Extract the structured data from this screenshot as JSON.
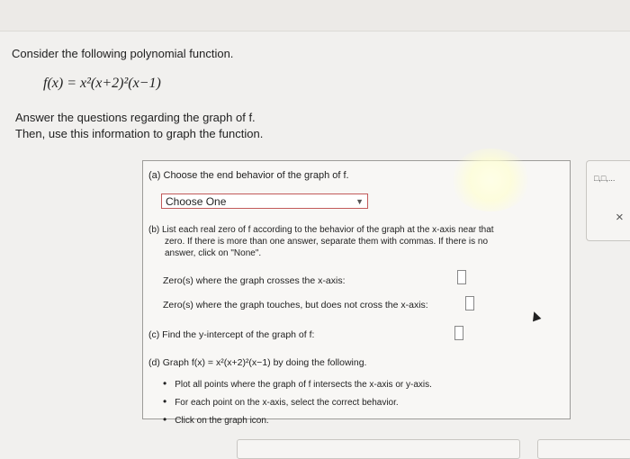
{
  "intro": "Consider the following polynomial function.",
  "formula": "f(x) = x²(x+2)²(x−1)",
  "answer_line1": "Answer the questions regarding the graph of f.",
  "answer_line2": "Then, use this information to graph the function.",
  "part_a": {
    "label": "(a) Choose the end behavior of the graph of f.",
    "select_value": "Choose One"
  },
  "part_b": {
    "line1": "(b) List each real zero of f according to the behavior of the graph at the x-axis near that",
    "line2": "zero. If there is more than one answer, separate them with commas. If there is no",
    "line3": "answer, click on \"None\".",
    "crosses_label": "Zero(s) where the graph crosses the x-axis:",
    "touches_label": "Zero(s) where the graph touches, but does not cross the x-axis:"
  },
  "part_c": {
    "label": "(c) Find the y-intercept of the graph of f:"
  },
  "part_d": {
    "label": "(d) Graph f(x) = x²(x+2)²(x−1) by doing the following.",
    "bullets": [
      "Plot all points where the graph of f intersects the x-axis or y-axis.",
      "For each point on the x-axis, select the correct behavior.",
      "Click on the graph icon."
    ]
  },
  "side": {
    "icon_label": "□,□,...",
    "close": "×"
  }
}
